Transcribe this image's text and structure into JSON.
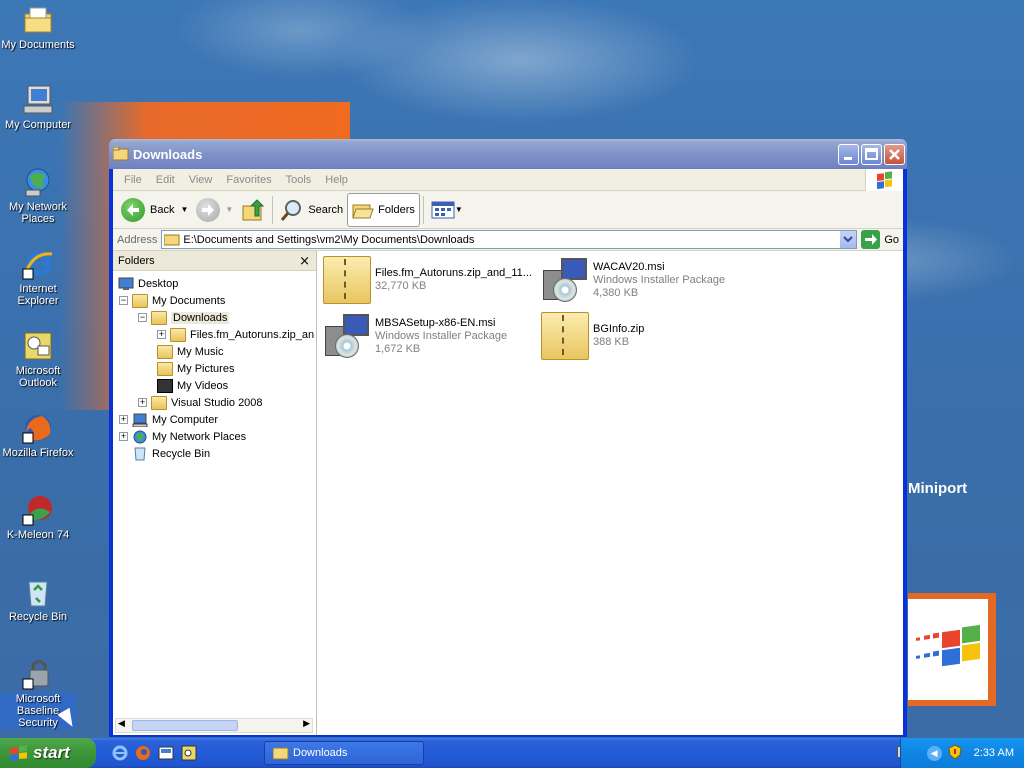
{
  "desktop": {
    "icons": [
      {
        "label": "My Documents",
        "icon": "my-documents-icon"
      },
      {
        "label": "My Computer",
        "icon": "my-computer-icon"
      },
      {
        "label": "My Network Places",
        "icon": "network-places-icon"
      },
      {
        "label": "Internet Explorer",
        "icon": "internet-explorer-icon"
      },
      {
        "label": "Microsoft Outlook",
        "icon": "outlook-icon"
      },
      {
        "label": "Mozilla Firefox",
        "icon": "firefox-icon"
      },
      {
        "label": "K-Meleon 74",
        "icon": "k-meleon-icon"
      },
      {
        "label": "Recycle Bin",
        "icon": "recycle-bin-icon"
      },
      {
        "label": "Microsoft Baseline Security",
        "icon": "mbsa-icon"
      }
    ],
    "background_text": "r Miniport"
  },
  "window": {
    "title": "Downloads",
    "menu": [
      "File",
      "Edit",
      "View",
      "Favorites",
      "Tools",
      "Help"
    ],
    "toolbar": {
      "back_label": "Back",
      "search_label": "Search",
      "folders_label": "Folders"
    },
    "address": {
      "label": "Address",
      "value": "E:\\Documents and Settings\\vm2\\My Documents\\Downloads",
      "go_label": "Go"
    },
    "folders_pane": {
      "title": "Folders",
      "close_glyph": "×",
      "tree": [
        {
          "label": "Desktop",
          "level": 0,
          "expander": ""
        },
        {
          "label": "My Documents",
          "level": 1,
          "expander": "−"
        },
        {
          "label": "Downloads",
          "level": 2,
          "expander": "−",
          "selected": true
        },
        {
          "label": "Files.fm_Autoruns.zip_an",
          "level": 3,
          "expander": "+"
        },
        {
          "label": "My Music",
          "level": 2,
          "expander": ""
        },
        {
          "label": "My Pictures",
          "level": 2,
          "expander": ""
        },
        {
          "label": "My Videos",
          "level": 2,
          "expander": ""
        },
        {
          "label": "Visual Studio 2008",
          "level": 2,
          "expander": "+"
        },
        {
          "label": "My Computer",
          "level": 1,
          "expander": "+"
        },
        {
          "label": "My Network Places",
          "level": 1,
          "expander": "+"
        },
        {
          "label": "Recycle Bin",
          "level": 1,
          "expander": ""
        }
      ]
    },
    "files": [
      {
        "name": "Files.fm_Autoruns.zip_and_11...",
        "type": "",
        "size": "32,770 KB",
        "kind": "zip"
      },
      {
        "name": "WACAV20.msi",
        "type": "Windows Installer Package",
        "size": "4,380 KB",
        "kind": "msi"
      },
      {
        "name": "MBSASetup-x86-EN.msi",
        "type": "Windows Installer Package",
        "size": "1,672 KB",
        "kind": "msi"
      },
      {
        "name": "BGInfo.zip",
        "type": "",
        "size": "388 KB",
        "kind": "zip"
      }
    ]
  },
  "taskbar": {
    "start_label": "start",
    "task_label": "Downloads",
    "clock": "2:33 AM"
  }
}
